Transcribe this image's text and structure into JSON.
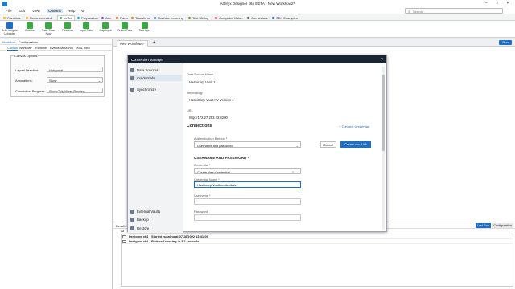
{
  "window": {
    "title": "Alteryx Designer x64 BETA - New Workflow2*",
    "controls": [
      "–",
      "□",
      "✕"
    ]
  },
  "menu": {
    "items": [
      "File",
      "Edit",
      "View",
      "Options",
      "Help"
    ],
    "active_index": 3,
    "search_placeholder": "Search"
  },
  "tool_tabs": [
    {
      "label": "Favorites",
      "color": "#f0b400"
    },
    {
      "label": "Recommended",
      "color": "#e0a000"
    },
    {
      "label": "In/Out",
      "color": "#3aa845"
    },
    {
      "label": "Preparation",
      "color": "#1fa3b5"
    },
    {
      "label": "Join",
      "color": "#8d4ab8"
    },
    {
      "label": "Parse",
      "color": "#d0541b"
    },
    {
      "label": "Transform",
      "color": "#d07a1b"
    },
    {
      "label": "Machine Learning",
      "color": "#2a6fc0"
    },
    {
      "label": "Text Mining",
      "color": "#6b8f2a"
    },
    {
      "label": "Computer Vision",
      "color": "#c23a6c"
    },
    {
      "label": "Connectors",
      "color": "#5a5a5a"
    },
    {
      "label": "SDK Examples",
      "color": "#3d62b3"
    }
  ],
  "toolbar": [
    {
      "label": "Auto Insights Uploader",
      "color": "#1d6ec4"
    },
    {
      "label": "Browse",
      "color": "#3aa845"
    },
    {
      "label": "Date Time Now",
      "color": "#3aa845"
    },
    {
      "label": "Directory",
      "color": "#3aa845"
    },
    {
      "label": "Input Data",
      "color": "#3aa845"
    },
    {
      "label": "Map Input",
      "color": "#3aa845"
    },
    {
      "label": "Output Data",
      "color": "#3aa845"
    },
    {
      "label": "Text Input",
      "color": "#3aa845"
    }
  ],
  "left_panel": {
    "tabs": [
      "Workflow",
      "Configuration"
    ],
    "subtabs": [
      "Canvas",
      "Workflow",
      "Runtime",
      "Events",
      "Meta Info",
      "XML View"
    ],
    "group_title": "Canvas Options",
    "fields": [
      {
        "label": "Layout Direction:",
        "value": "Horizontal"
      },
      {
        "label": "Annotations:",
        "value": "Show"
      },
      {
        "label": "Connection Progress:",
        "value": "Show Only When Running"
      }
    ]
  },
  "workflow": {
    "tab_label": "New Workflow2*",
    "add": "+",
    "run_label": "Run"
  },
  "results": {
    "title": "Results",
    "filter_label": "All",
    "last_run_label": "Last Run",
    "config_label": "Configuration",
    "log": [
      {
        "source": "Designer x64",
        "message": "Started running at 07/18/2022 13:41:09"
      },
      {
        "source": "Designer x64",
        "message": "Finished running in 3.2 seconds"
      }
    ]
  },
  "modal": {
    "title": "Connection Manager",
    "nav": [
      {
        "label": "Data Sources",
        "color": "#6a7a8c"
      },
      {
        "label": "Credentials",
        "color": "#6a7a8c"
      },
      {
        "label": "Synchronize",
        "color": "#6a7a8c"
      },
      {
        "label": "External Vaults",
        "color": "#6a7a8c"
      },
      {
        "label": "Backup",
        "color": "#6a7a8c"
      },
      {
        "label": "Restore",
        "color": "#6a7a8c"
      }
    ],
    "data_source_name_label": "Data Source Name",
    "data_source_name": "Hashicorp Vault 1",
    "technology_label": "Technology",
    "technology": "HashiCorp Vault KV Version 1",
    "url_label": "URL",
    "url": "http://172.27.253.23:8200",
    "connections_title": "Connections",
    "connect_credential_link": "+ Connect Credential",
    "auth_method_label": "Authentication Method *",
    "auth_method": "Username and password",
    "cancel_label": "Cancel",
    "create_link_label": "Create and Link",
    "username_password_title": "USERNAME AND PASSWORD *",
    "credential_label": "Credential *",
    "credential_value": "Create New Credential",
    "credential_name_label": "Credential Name *",
    "credential_name_value": "Hashicorp Vault credentials",
    "username_label": "Username *",
    "username_value": "",
    "password_label": "Password",
    "password_value": ""
  }
}
